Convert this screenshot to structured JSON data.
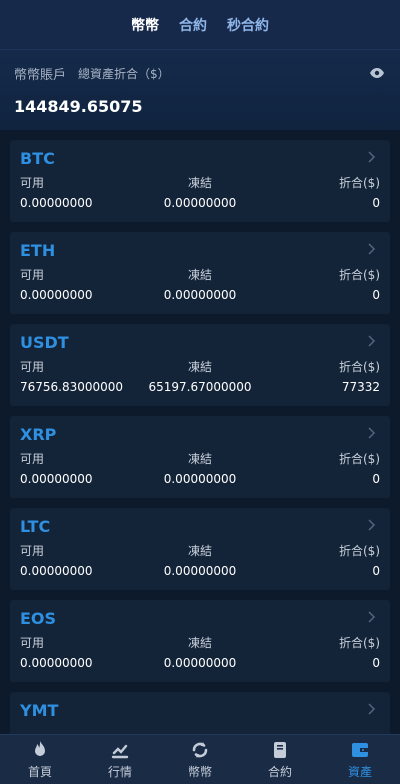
{
  "top_tabs": [
    {
      "label": "幣幣",
      "active": true
    },
    {
      "label": "合約",
      "active": false
    },
    {
      "label": "秒合約",
      "active": false
    }
  ],
  "summary": {
    "account_label": "幣幣賬戶",
    "sub_label": "總資產折合（$）",
    "total": "144849.65075",
    "eye_icon": "eye-icon"
  },
  "column_labels": {
    "available": "可用",
    "frozen": "凍結",
    "converted": "折合($)"
  },
  "assets": [
    {
      "name": "BTC",
      "available": "0.00000000",
      "frozen": "0.00000000",
      "converted": "0"
    },
    {
      "name": "ETH",
      "available": "0.00000000",
      "frozen": "0.00000000",
      "converted": "0"
    },
    {
      "name": "USDT",
      "available": "76756.83000000",
      "frozen": "65197.67000000",
      "converted": "77332"
    },
    {
      "name": "XRP",
      "available": "0.00000000",
      "frozen": "0.00000000",
      "converted": "0"
    },
    {
      "name": "LTC",
      "available": "0.00000000",
      "frozen": "0.00000000",
      "converted": "0"
    },
    {
      "name": "EOS",
      "available": "0.00000000",
      "frozen": "0.00000000",
      "converted": "0"
    },
    {
      "name": "YMT",
      "available": "",
      "frozen": "",
      "converted": ""
    }
  ],
  "bottom_nav": [
    {
      "label": "首頁",
      "icon": "flame-icon",
      "active": false
    },
    {
      "label": "行情",
      "icon": "market-icon",
      "active": false
    },
    {
      "label": "幣幣",
      "icon": "exchange-icon",
      "active": false
    },
    {
      "label": "合約",
      "icon": "contract-icon",
      "active": false
    },
    {
      "label": "資產",
      "icon": "wallet-icon",
      "active": true
    }
  ],
  "colors": {
    "accent": "#2f8fe0",
    "background": "#0d1a2b",
    "card": "#132338",
    "header": "#17294a"
  }
}
